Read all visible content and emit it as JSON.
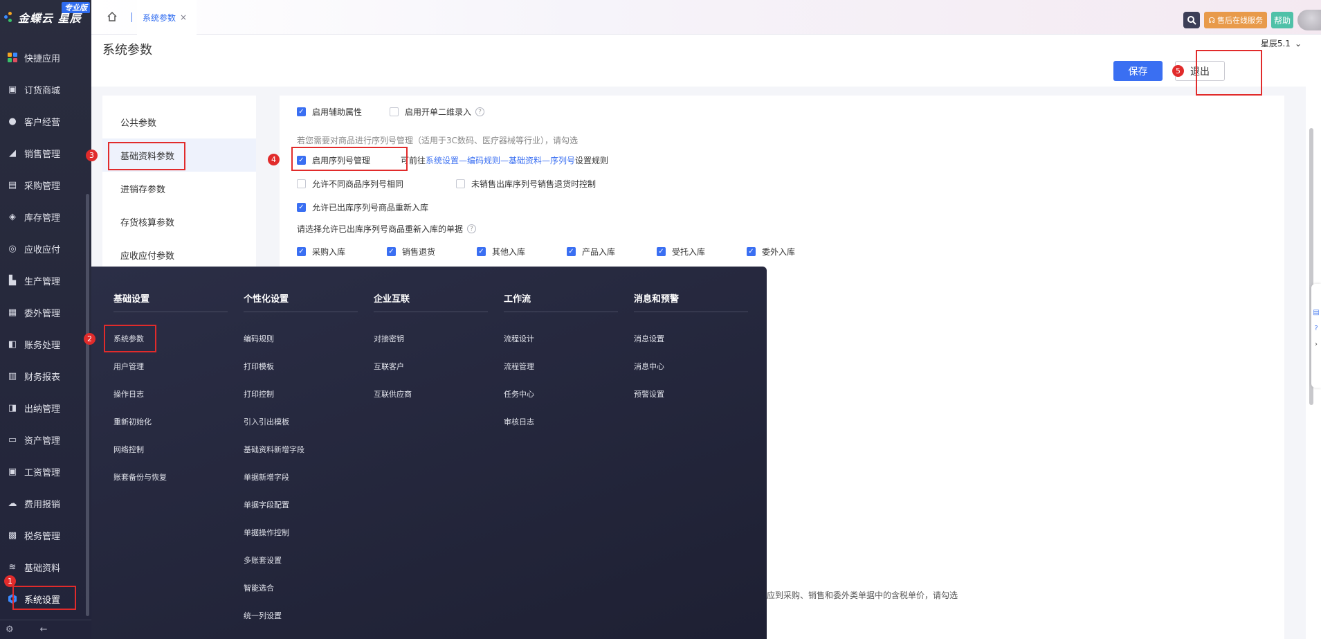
{
  "app": {
    "logo_text": "金蝶云 星辰",
    "edition": "专业版"
  },
  "sidebar": {
    "items": [
      {
        "label": "快捷应用",
        "icon": "apps-icon"
      },
      {
        "label": "订货商城",
        "icon": "shop-icon"
      },
      {
        "label": "客户经营",
        "icon": "customer-icon"
      },
      {
        "label": "销售管理",
        "icon": "sales-icon"
      },
      {
        "label": "采购管理",
        "icon": "cart-icon"
      },
      {
        "label": "库存管理",
        "icon": "box-icon"
      },
      {
        "label": "应收应付",
        "icon": "receivable-icon"
      },
      {
        "label": "生产管理",
        "icon": "factory-icon"
      },
      {
        "label": "委外管理",
        "icon": "outsource-icon"
      },
      {
        "label": "账务处理",
        "icon": "ledger-icon"
      },
      {
        "label": "财务报表",
        "icon": "report-icon"
      },
      {
        "label": "出纳管理",
        "icon": "cashier-icon"
      },
      {
        "label": "资产管理",
        "icon": "asset-icon"
      },
      {
        "label": "工资管理",
        "icon": "salary-icon"
      },
      {
        "label": "费用报销",
        "icon": "expense-icon"
      },
      {
        "label": "税务管理",
        "icon": "tax-icon"
      },
      {
        "label": "基础资料",
        "icon": "layers-icon"
      },
      {
        "label": "系统设置",
        "icon": "settings-icon"
      }
    ]
  },
  "topbar": {
    "tab_label": "系统参数",
    "tab_close": "×",
    "service_label": "售后在线服务",
    "help_label": "帮助"
  },
  "header": {
    "page_title": "系统参数",
    "version": "星辰5.1",
    "save_label": "保存",
    "exit_label": "退出"
  },
  "left_menu": {
    "items": [
      "公共参数",
      "基础资料参数",
      "进销存参数",
      "存货核算参数",
      "应收应付参数"
    ]
  },
  "options": {
    "aux_attr": {
      "label": "启用辅助属性",
      "checked": true
    },
    "qr_entry": {
      "label": "启用开单二维录入",
      "checked": false
    },
    "serial_note": "若您需要对商品进行序列号管理（适用于3C数码、医疗器械等行业），请勾选",
    "serial_enable": {
      "label": "启用序列号管理",
      "checked": true
    },
    "serial_link_prefix": "可前往",
    "serial_link": "系统设置—编码规则—基础资料—序列号",
    "serial_link_suffix": "设置规则",
    "allow_same": {
      "label": "允许不同商品序列号相同",
      "checked": false
    },
    "unsold_return": {
      "label": "未销售出库序列号销售退货时控制",
      "checked": false
    },
    "allow_reentry": {
      "label": "允许已出库序列号商品重新入库",
      "checked": true
    },
    "select_docs_label": "请选择允许已出库序列号商品重新入库的单据",
    "docs": [
      {
        "label": "采购入库",
        "checked": true
      },
      {
        "label": "销售退货",
        "checked": true
      },
      {
        "label": "其他入库",
        "checked": true
      },
      {
        "label": "产品入库",
        "checked": true
      },
      {
        "label": "受托入库",
        "checked": true
      },
      {
        "label": "委外入库",
        "checked": true
      }
    ],
    "bottom_note": "应到采购、销售和委外类单据中的含税单价，请勾选"
  },
  "mega_menu": {
    "columns": [
      {
        "title": "基础设置",
        "items": [
          "系统参数",
          "用户管理",
          "操作日志",
          "重新初始化",
          "网络控制",
          "账套备份与恢复"
        ]
      },
      {
        "title": "个性化设置",
        "items": [
          "编码规则",
          "打印模板",
          "打印控制",
          "引入引出模板",
          "基础资料新增字段",
          "单据新增字段",
          "单据字段配置",
          "单据操作控制",
          "多账套设置",
          "智能选合",
          "统一列设置"
        ]
      },
      {
        "title": "企业互联",
        "items": [
          "对接密钥",
          "互联客户",
          "互联供应商"
        ]
      },
      {
        "title": "工作流",
        "items": [
          "流程设计",
          "流程管理",
          "任务中心",
          "审核日志"
        ]
      },
      {
        "title": "消息和预警",
        "items": [
          "消息设置",
          "消息中心",
          "预警设置"
        ]
      }
    ]
  },
  "annotations": [
    "1",
    "2",
    "3",
    "4",
    "5"
  ],
  "colors": {
    "accent": "#3a6ff2",
    "annotation": "#e12b2b",
    "sidebar_bg": "#2a2d3e"
  }
}
